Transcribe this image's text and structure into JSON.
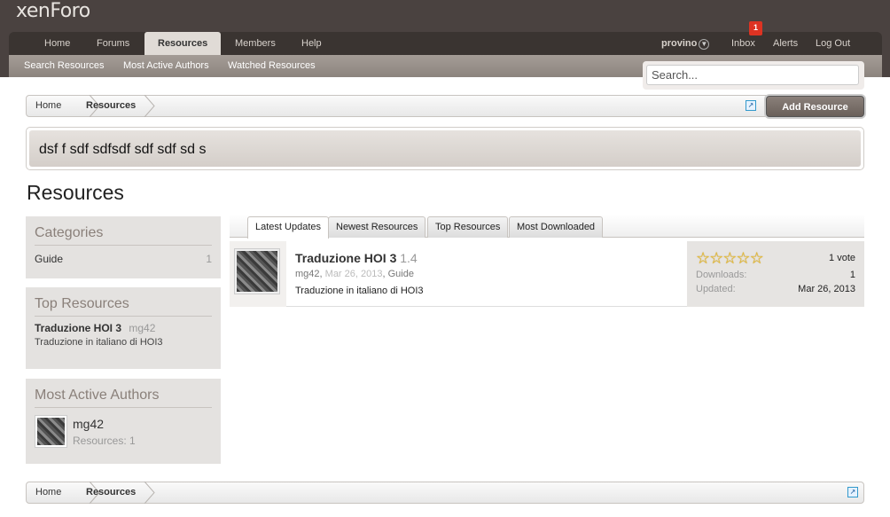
{
  "logo": "xenForo",
  "nav": {
    "tabs": [
      "Home",
      "Forums",
      "Resources",
      "Members",
      "Help"
    ],
    "user": "provino",
    "inbox": "Inbox",
    "inbox_count": "1",
    "alerts": "Alerts",
    "logout": "Log Out"
  },
  "subnav": [
    "Search Resources",
    "Most Active Authors",
    "Watched Resources"
  ],
  "search": {
    "placeholder": "Search..."
  },
  "breadcrumb": [
    "Home",
    "Resources"
  ],
  "add_resource": "Add Resource",
  "notice": "dsf f sdf sdfsdf sdf sdf sd s",
  "page_title": "Resources",
  "sidebar": {
    "categories": {
      "title": "Categories",
      "items": [
        {
          "name": "Guide",
          "count": "1"
        }
      ]
    },
    "top_resources": {
      "title": "Top Resources",
      "name": "Traduzione HOI 3",
      "author": "mg42",
      "desc": "Traduzione in italiano di HOI3"
    },
    "active_authors": {
      "title": "Most Active Authors",
      "name": "mg42",
      "resources": "Resources: 1"
    }
  },
  "tabs": [
    "Latest Updates",
    "Newest Resources",
    "Top Resources",
    "Most Downloaded"
  ],
  "resource": {
    "title": "Traduzione HOI 3",
    "version": "1.4",
    "author": "mg42",
    "date": "Mar 26, 2013",
    "category": "Guide",
    "desc": "Traduzione in italiano di HOI3",
    "rating": 5,
    "votes": "1 vote",
    "downloads_label": "Downloads:",
    "downloads": "1",
    "updated_label": "Updated:",
    "updated": "Mar 26, 2013"
  },
  "colors": {
    "header": "#4a4240",
    "navbar": "#3a3431",
    "subnav": "#9a928c"
  }
}
